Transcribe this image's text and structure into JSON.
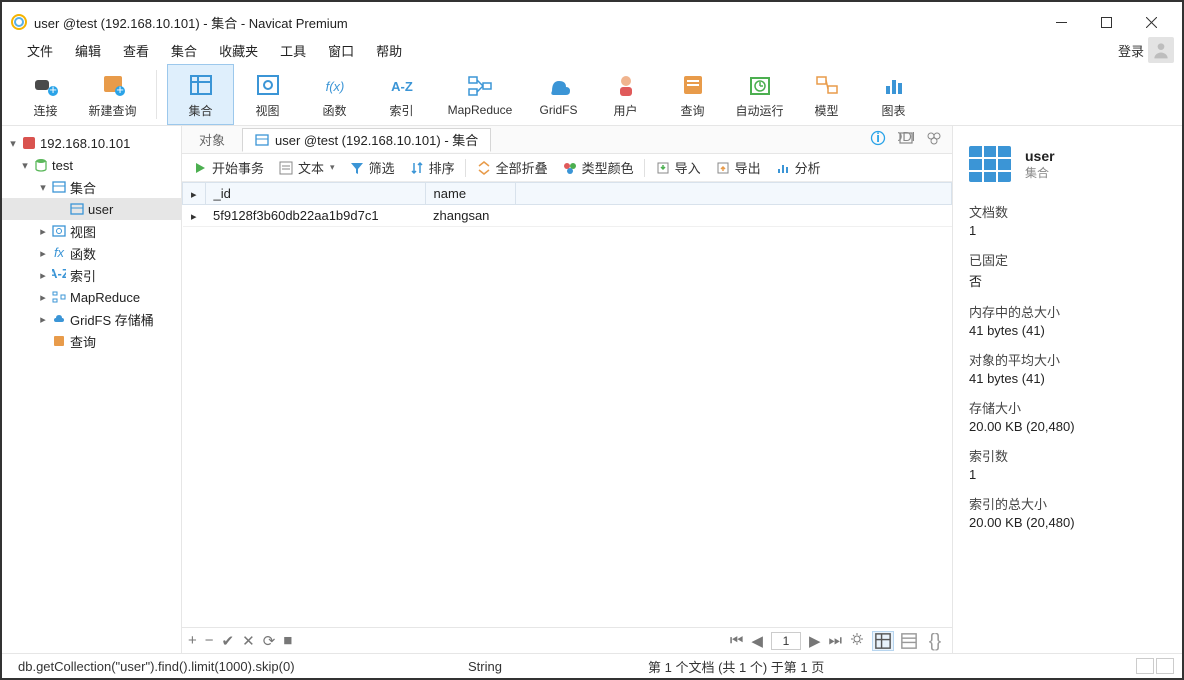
{
  "title": "user @test (192.168.10.101) - 集合 - Navicat Premium",
  "menu": [
    "文件",
    "编辑",
    "查看",
    "集合",
    "收藏夹",
    "工具",
    "窗口",
    "帮助"
  ],
  "login_label": "登录",
  "toolbar": [
    {
      "label": "连接",
      "icon": "plug"
    },
    {
      "label": "新建查询",
      "icon": "query"
    },
    {
      "sep": true
    },
    {
      "label": "集合",
      "icon": "table",
      "selected": true
    },
    {
      "label": "视图",
      "icon": "view"
    },
    {
      "label": "函数",
      "icon": "fx"
    },
    {
      "label": "索引",
      "icon": "az"
    },
    {
      "label": "MapReduce",
      "icon": "mr"
    },
    {
      "label": "GridFS",
      "icon": "gridfs"
    },
    {
      "label": "用户",
      "icon": "user"
    },
    {
      "label": "查询",
      "icon": "doc"
    },
    {
      "label": "自动运行",
      "icon": "clock"
    },
    {
      "label": "模型",
      "icon": "model"
    },
    {
      "label": "图表",
      "icon": "chart"
    }
  ],
  "tree": {
    "conn": "192.168.10.101",
    "db": "test",
    "folders": {
      "collections": "集合",
      "user_item": "user",
      "views": "视图",
      "functions": "函数",
      "indexes": "索引",
      "mapreduce": "MapReduce",
      "gridfs": "GridFS 存储桶",
      "query": "查询"
    }
  },
  "tabs": {
    "inactive": "对象",
    "active": "user @test (192.168.10.101) - 集合"
  },
  "actionbar": {
    "start_tx": "开始事务",
    "text": "文本",
    "filter": "筛选",
    "sort": "排序",
    "collapse_all": "全部折叠",
    "type_color": "类型颜色",
    "import": "导入",
    "export": "导出",
    "analyze": "分析"
  },
  "table": {
    "columns": [
      "_id",
      "name"
    ],
    "rows": [
      {
        "_id": "5f9128f3b60db22aa1b9d7c1",
        "name": "zhangsan"
      }
    ]
  },
  "pager": {
    "page": "1"
  },
  "right": {
    "name": "user",
    "sub": "集合",
    "props": [
      {
        "k": "文档数",
        "v": "1"
      },
      {
        "k": "已固定",
        "v": "否"
      },
      {
        "k": "内存中的总大小",
        "v": "41 bytes (41)"
      },
      {
        "k": "对象的平均大小",
        "v": "41 bytes (41)"
      },
      {
        "k": "存储大小",
        "v": "20.00 KB (20,480)"
      },
      {
        "k": "索引数",
        "v": "1"
      },
      {
        "k": "索引的总大小",
        "v": "20.00 KB (20,480)"
      }
    ]
  },
  "status": {
    "query": "db.getCollection(\"user\").find().limit(1000).skip(0)",
    "type": "String",
    "position": "第 1 个文档 (共 1 个) 于第 1 页"
  }
}
